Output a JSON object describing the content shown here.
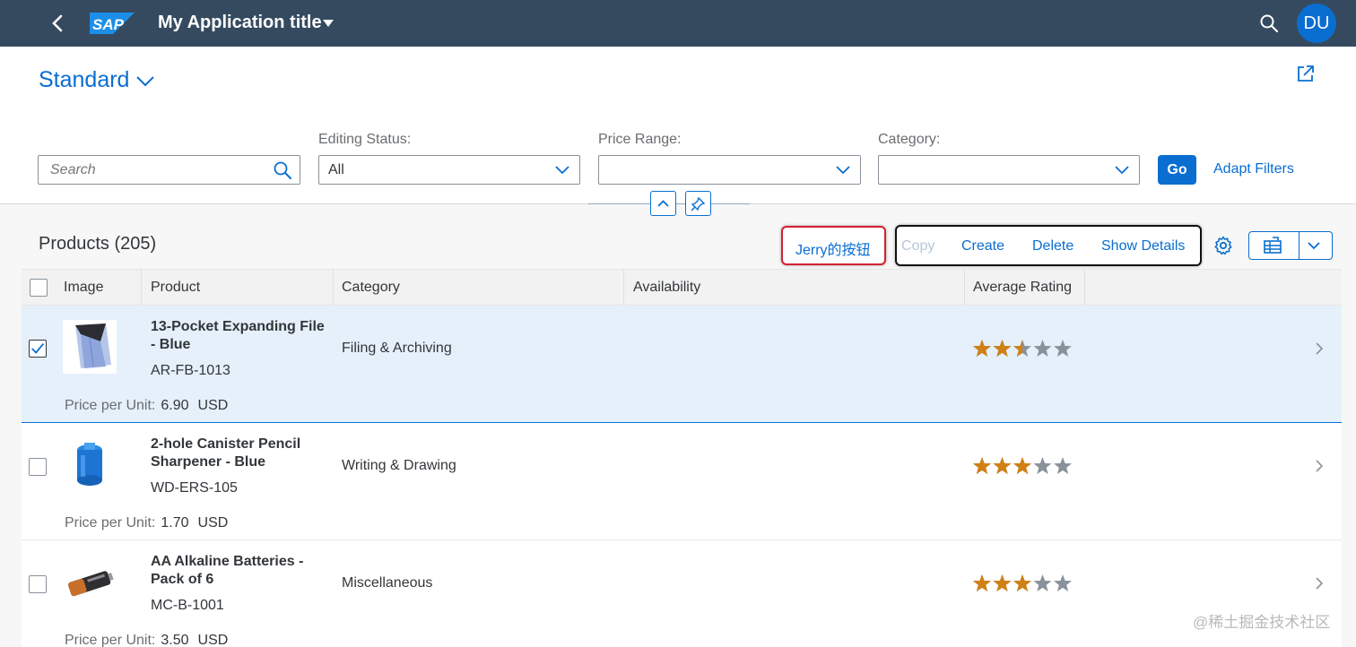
{
  "shell": {
    "title": "My Application title",
    "logo_text": "SAP",
    "avatar_initials": "DU",
    "icons": [
      "back-icon",
      "sap-logo",
      "title-caret-icon",
      "search-icon"
    ],
    "colors": {
      "shell_bg": "#354a5f",
      "avatar_bg": "#0a6ed1"
    }
  },
  "header": {
    "variant": "Standard",
    "filters": {
      "search_placeholder": "Search",
      "editing_status_label": "Editing Status:",
      "editing_status_value": "All",
      "price_range_label": "Price Range:",
      "price_range_value": "",
      "category_label": "Category:",
      "category_value": ""
    },
    "go_label": "Go",
    "adapt_filters_label": "Adapt Filters"
  },
  "table": {
    "title": "Products (205)",
    "toolbar": {
      "custom_label": "Jerry的按钮",
      "copy_label": "Copy",
      "create_label": "Create",
      "delete_label": "Delete",
      "show_details_label": "Show Details"
    },
    "columns": [
      "Image",
      "Product",
      "Category",
      "Availability",
      "Average Rating"
    ],
    "price_label": "Price per Unit:",
    "rows": [
      {
        "selected": true,
        "name": "13-Pocket Expanding File - Blue",
        "id": "AR-FB-1013",
        "category": "Filing & Archiving",
        "rating": 2.5,
        "price": "6.90",
        "currency": "USD"
      },
      {
        "selected": false,
        "name": "2-hole Canister Pencil Sharpener - Blue",
        "id": "WD-ERS-105",
        "category": "Writing & Drawing",
        "rating": 3,
        "price": "1.70",
        "currency": "USD"
      },
      {
        "selected": false,
        "name": "AA Alkaline Batteries - Pack of 6",
        "id": "MC-B-1001",
        "category": "Miscellaneous",
        "rating": 3,
        "price": "3.50",
        "currency": "USD"
      }
    ],
    "rating_max": 5,
    "colors": {
      "star_filled": "#d08014",
      "star_empty": "#89919a",
      "selected_row": "#e5f0fa",
      "accent": "#0a6ed1",
      "highlight_red": "#d32030"
    }
  },
  "watermark": "@稀土掘金技术社区"
}
